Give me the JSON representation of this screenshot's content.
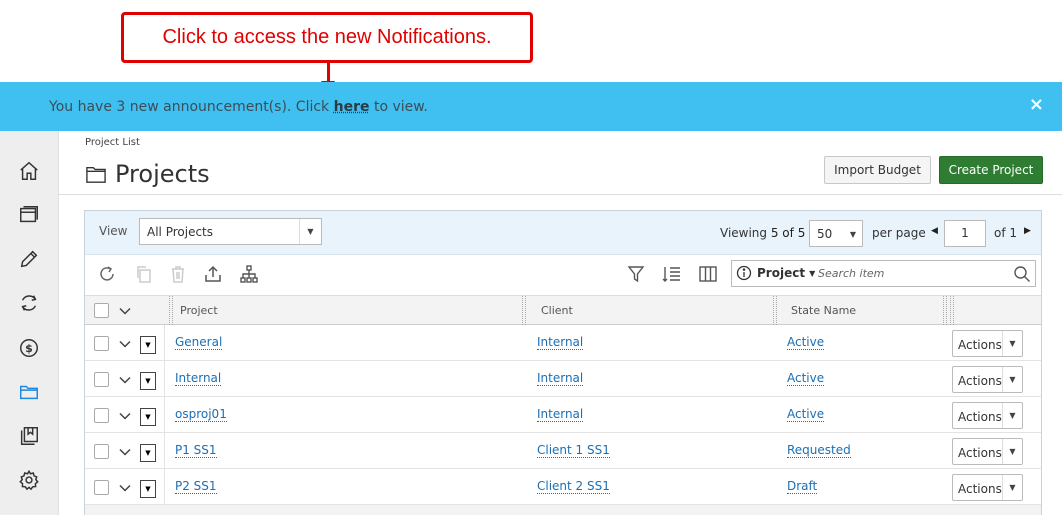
{
  "callout": {
    "text": "Click to access the new Notifications."
  },
  "announcement": {
    "prefix": "You have 3 new announcement(s). Click ",
    "link": "here",
    "suffix": " to view.",
    "close": "×"
  },
  "sidebar": {
    "items": [
      {
        "icon": "home-icon"
      },
      {
        "icon": "timesheet-icon"
      },
      {
        "icon": "pencil-icon"
      },
      {
        "icon": "sync-icon"
      },
      {
        "icon": "dollar-icon"
      },
      {
        "icon": "folder-icon",
        "active": true
      },
      {
        "icon": "book-icon"
      },
      {
        "icon": "gear-icon"
      }
    ]
  },
  "header": {
    "breadcrumb": "Project List",
    "title": "Projects",
    "import_label": "Import Budget",
    "create_label": "Create Project"
  },
  "filter": {
    "view_label": "View",
    "view_value": "All Projects",
    "viewing_prefix": "Viewing ",
    "viewing_range": "5 of 5",
    "per_page_value": "50",
    "per_page_label": "per page",
    "page_value": "1",
    "page_of": "of 1"
  },
  "search": {
    "scope": "Project",
    "placeholder": "Search item"
  },
  "table": {
    "columns": [
      "Project",
      "Client",
      "State Name"
    ],
    "rows": [
      {
        "project": "General",
        "client": "Internal",
        "state": "Active",
        "action": "Actions"
      },
      {
        "project": "Internal",
        "client": "Internal",
        "state": "Active",
        "action": "Actions"
      },
      {
        "project": "osproj01",
        "client": "Internal",
        "state": "Active",
        "action": "Actions"
      },
      {
        "project": "P1 SS1",
        "client": "Client 1 SS1",
        "state": "Requested",
        "action": "Actions"
      },
      {
        "project": "P2 SS1",
        "client": "Client 2 SS1",
        "state": "Draft",
        "action": "Actions"
      }
    ]
  },
  "colors": {
    "announcement_bg": "#3fc0f0",
    "callout_red": "#e00000",
    "primary_green": "#2e7d32",
    "link_blue": "#1a6fb5",
    "active_nav": "#1e88e5"
  }
}
